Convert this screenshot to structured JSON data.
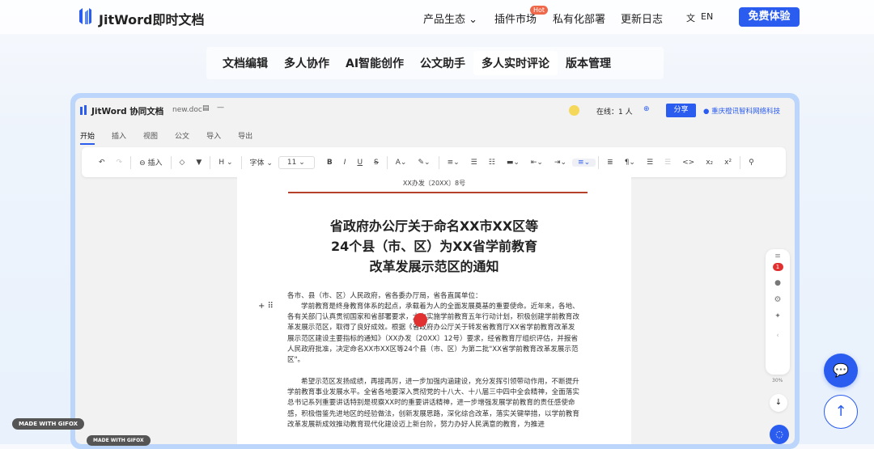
{
  "nav": {
    "brand": "JitWord即时文档",
    "items": [
      "产品生态 ⌄",
      "插件市场",
      "私有化部署",
      "更新日志"
    ],
    "hot": "Hot",
    "lang_icon": "translate-icon",
    "lang": "EN",
    "trial": "免费体验"
  },
  "feature_tabs": [
    "文档编辑",
    "多人协作",
    "AI智能创作",
    "公文助手",
    "多人实时评论",
    "版本管理"
  ],
  "app": {
    "title": "JitWord 协同文档",
    "doc_name": "new.doc",
    "online": "在线：1 人",
    "share": "分享",
    "user": "重庆橙讯智科网络科技",
    "menu_tabs": [
      "开始",
      "插入",
      "视图",
      "公文",
      "导入",
      "导出"
    ],
    "toolbar": {
      "insert": "⊖ 插入",
      "heading": "H ⌄",
      "font": "字体 ⌄",
      "size": "11"
    },
    "doc": {
      "doc_number": "XX办发〔20XX〕8号",
      "title_lines": [
        "省政府办公厅关于命名XX市XX区等",
        "24个县（市、区）为XX省学前教育",
        "改革发展示范区的通知"
      ],
      "addressee": "各市、县（市、区）人民政府，省各委办厅局，省各直属单位：",
      "para1": "学前教育是终身教育体系的起点，承载着为人的全面发展奠基的重要使命。近年来，各地、各有关部门认真贯彻国家和省部署要求，大力实施学前教育五年行动计划，积极创建学前教育改革发展示范区，取得了良好成效。根据《省政府办公厅关于转发省教育厅XX省学前教育改革发展示范区建设主要指标的通知》（XX办发〔20XX〕12号）要求，经省教育厅组织评估，并报省人民政府批准，决定命名XX市XX区等24个县（市、区）为第二批\"XX省学前教育改革发展示范区\"。",
      "para2": "希望示范区发扬成绩，再接再厉，进一步加强内涵建设，充分发挥引领带动作用，不断提升学前教育事业发展水平。全省各地要深入贯彻党的十八大、十八届三中四中全会精神，全面落实总书记系列重要讲话特别是视察XX时的重要讲话精神，进一步增强发展学前教育的责任感使命感，积极借鉴先进地区的经验做法，创新发展思路，深化综合改革，落实关键举措，以学前教育改革发展新成效推动教育现代化建设迈上新台阶，努力办好人民满意的教育，为推进"
    },
    "comment_badge": "1",
    "progress": "30%"
  },
  "watermark": "MADE WITH GIFOX",
  "colors": {
    "accent": "#2a5cf0",
    "rule": "#b5412b"
  }
}
